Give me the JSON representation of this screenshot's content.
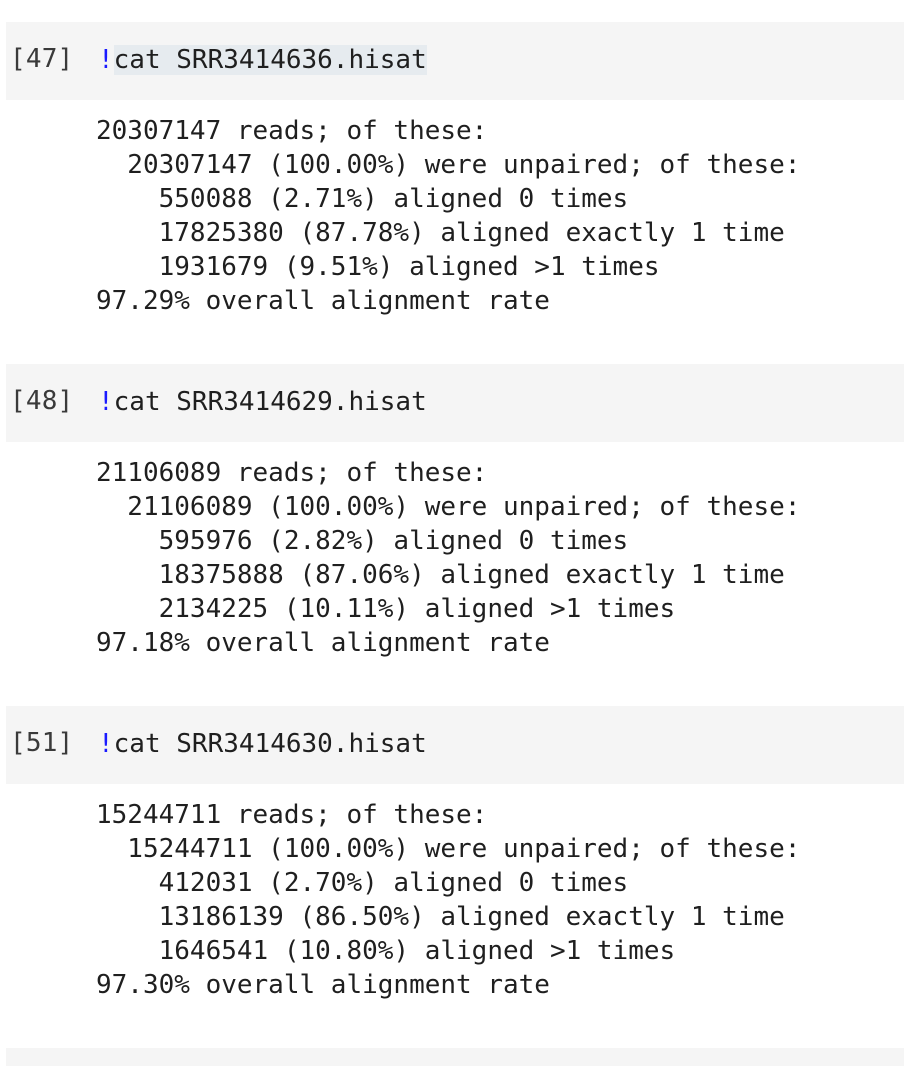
{
  "cells": [
    {
      "prompt": "[47]",
      "bang": "!",
      "command": "cat SRR3414636.hisat",
      "output": [
        "20307147 reads; of these:",
        "  20307147 (100.00%) were unpaired; of these:",
        "    550088 (2.71%) aligned 0 times",
        "    17825380 (87.78%) aligned exactly 1 time",
        "    1931679 (9.51%) aligned >1 times",
        "97.29% overall alignment rate"
      ]
    },
    {
      "prompt": "[48]",
      "bang": "!",
      "command": "cat SRR3414629.hisat",
      "output": [
        "21106089 reads; of these:",
        "  21106089 (100.00%) were unpaired; of these:",
        "    595976 (2.82%) aligned 0 times",
        "    18375888 (87.06%) aligned exactly 1 time",
        "    2134225 (10.11%) aligned >1 times",
        "97.18% overall alignment rate"
      ]
    },
    {
      "prompt": "[51]",
      "bang": "!",
      "command": "cat SRR3414630.hisat",
      "output": [
        "15244711 reads; of these:",
        "  15244711 (100.00%) were unpaired; of these:",
        "    412031 (2.70%) aligned 0 times",
        "    13186139 (86.50%) aligned exactly 1 time",
        "    1646541 (10.80%) aligned >1 times",
        "97.30% overall alignment rate"
      ]
    }
  ]
}
